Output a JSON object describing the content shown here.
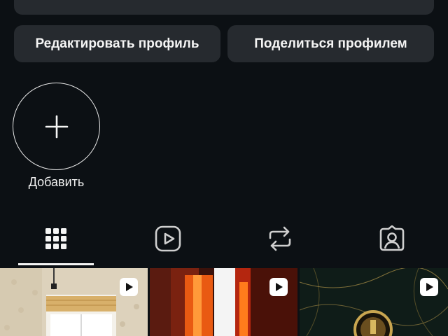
{
  "actions": {
    "edit_profile": "Редактировать профиль",
    "share_profile": "Поделиться профилем"
  },
  "highlights": {
    "add_label": "Добавить"
  },
  "tabs": [
    "grid-icon",
    "reels-icon",
    "reposts-icon",
    "tagged-icon"
  ],
  "selected_tab": "grid",
  "posts": [
    {
      "type": "reel",
      "icon": "play-icon"
    },
    {
      "type": "reel",
      "icon": "play-icon"
    },
    {
      "type": "reel",
      "icon": "play-icon"
    }
  ],
  "colors": {
    "background": "#0c1014",
    "button_bg": "#262a2f",
    "text": "#f5f5f5"
  }
}
